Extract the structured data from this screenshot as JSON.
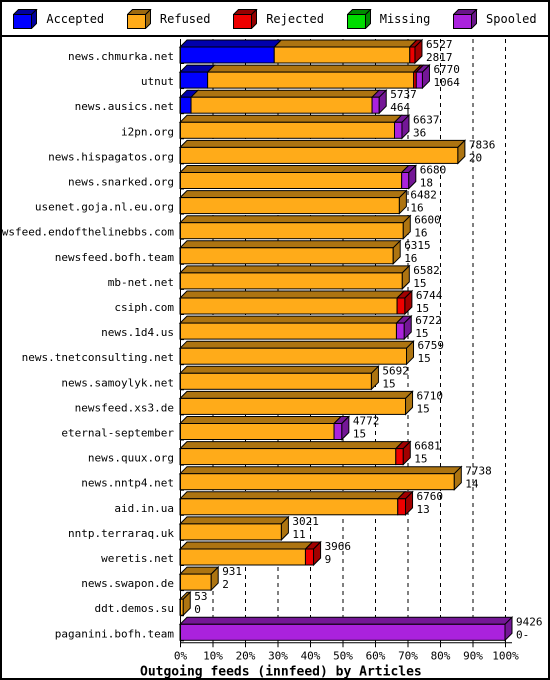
{
  "legend": {
    "items": [
      {
        "label": "Accepted",
        "color": "#0000ff",
        "icon": "cube-icon"
      },
      {
        "label": "Refused",
        "color": "#ffab19",
        "icon": "cube-icon"
      },
      {
        "label": "Rejected",
        "color": "#ee0000",
        "icon": "cube-icon"
      },
      {
        "label": "Missing",
        "color": "#00dd00",
        "icon": "cube-icon"
      },
      {
        "label": "Spooled",
        "color": "#aa22dd",
        "icon": "cube-icon"
      }
    ]
  },
  "chart_data": {
    "type": "bar",
    "orientation": "horizontal",
    "stacked": true,
    "title": "Outgoing feeds (innfeed) by Articles",
    "xlabel": "Outgoing feeds (innfeed) by Articles",
    "ylabel": "",
    "xlim": [
      0,
      100
    ],
    "x_tick_labels": [
      "0%",
      "10%",
      "20%",
      "30%",
      "40%",
      "50%",
      "60%",
      "70%",
      "80%",
      "90%",
      "100%"
    ],
    "x_tick_values": [
      0,
      10,
      20,
      30,
      40,
      50,
      60,
      70,
      80,
      90,
      100
    ],
    "grid": true,
    "legend_position": "top",
    "series": [
      {
        "name": "Accepted",
        "color": "#0000ff"
      },
      {
        "name": "Refused",
        "color": "#ffab19"
      },
      {
        "name": "Rejected",
        "color": "#ee0000"
      },
      {
        "name": "Missing",
        "color": "#00dd00"
      },
      {
        "name": "Spooled",
        "color": "#aa22dd"
      }
    ],
    "categories": [
      "news.chmurka.net",
      "utnut",
      "news.ausics.net",
      "i2pn.org",
      "news.hispagatos.org",
      "news.snarked.org",
      "usenet.goja.nl.eu.org",
      "newsfeed.endofthelinebbs.com",
      "newsfeed.bofh.team",
      "mb-net.net",
      "csiph.com",
      "news.1d4.us",
      "news.tnetconsulting.net",
      "news.samoylyk.net",
      "newsfeed.xs3.de",
      "eternal-september",
      "news.quux.org",
      "news.nntp4.net",
      "aid.in.ua",
      "nntp.terraraq.uk",
      "weretis.net",
      "news.swapon.de",
      "ddt.demos.su",
      "paganini.bofh.team"
    ],
    "rows": [
      {
        "category": "news.chmurka.net",
        "total": 6527,
        "label_top": "6527",
        "label_bottom": "2817",
        "segments": [
          {
            "series": "Accepted",
            "pct": 29.0
          },
          {
            "series": "Refused",
            "pct": 41.7
          },
          {
            "series": "Rejected",
            "pct": 1.6
          }
        ]
      },
      {
        "category": "utnut",
        "total": 6770,
        "label_top": "6770",
        "label_bottom": "1064",
        "segments": [
          {
            "series": "Accepted",
            "pct": 8.5
          },
          {
            "series": "Refused",
            "pct": 63.4
          },
          {
            "series": "Rejected",
            "pct": 0.8
          },
          {
            "series": "Spooled",
            "pct": 1.9
          }
        ]
      },
      {
        "category": "news.ausics.net",
        "total": 5737,
        "label_top": "5737",
        "label_bottom": "464",
        "segments": [
          {
            "series": "Accepted",
            "pct": 3.4
          },
          {
            "series": "Refused",
            "pct": 55.7
          },
          {
            "series": "Spooled",
            "pct": 2.2
          }
        ]
      },
      {
        "category": "i2pn.org",
        "total": 6637,
        "label_top": "6637",
        "label_bottom": "36",
        "segments": [
          {
            "series": "Refused",
            "pct": 66.0
          },
          {
            "series": "Spooled",
            "pct": 2.3
          }
        ]
      },
      {
        "category": "news.hispagatos.org",
        "total": 7836,
        "label_top": "7836",
        "label_bottom": "20",
        "segments": [
          {
            "series": "Refused",
            "pct": 85.5
          }
        ]
      },
      {
        "category": "news.snarked.org",
        "total": 6680,
        "label_top": "6680",
        "label_bottom": "18",
        "segments": [
          {
            "series": "Refused",
            "pct": 68.2
          },
          {
            "series": "Spooled",
            "pct": 2.2
          }
        ]
      },
      {
        "category": "usenet.goja.nl.eu.org",
        "total": 6482,
        "label_top": "6482",
        "label_bottom": "16",
        "segments": [
          {
            "series": "Refused",
            "pct": 67.5
          }
        ]
      },
      {
        "category": "newsfeed.endofthelinebbs.com",
        "total": 6600,
        "label_top": "6600",
        "label_bottom": "16",
        "segments": [
          {
            "series": "Refused",
            "pct": 68.7
          }
        ]
      },
      {
        "category": "newsfeed.bofh.team",
        "total": 6315,
        "label_top": "6315",
        "label_bottom": "16",
        "segments": [
          {
            "series": "Refused",
            "pct": 65.6
          }
        ]
      },
      {
        "category": "mb-net.net",
        "total": 6582,
        "label_top": "6582",
        "label_bottom": "15",
        "segments": [
          {
            "series": "Refused",
            "pct": 68.4
          }
        ]
      },
      {
        "category": "csiph.com",
        "total": 6744,
        "label_top": "6744",
        "label_bottom": "15",
        "segments": [
          {
            "series": "Refused",
            "pct": 66.8
          },
          {
            "series": "Rejected",
            "pct": 2.4
          }
        ]
      },
      {
        "category": "news.1d4.us",
        "total": 6722,
        "label_top": "6722",
        "label_bottom": "15",
        "segments": [
          {
            "series": "Refused",
            "pct": 66.6
          },
          {
            "series": "Spooled",
            "pct": 2.4
          }
        ]
      },
      {
        "category": "news.tnetconsulting.net",
        "total": 6759,
        "label_top": "6759",
        "label_bottom": "15",
        "segments": [
          {
            "series": "Refused",
            "pct": 69.7
          }
        ]
      },
      {
        "category": "news.samoylyk.net",
        "total": 5692,
        "label_top": "5692",
        "label_bottom": "15",
        "segments": [
          {
            "series": "Refused",
            "pct": 58.9
          }
        ]
      },
      {
        "category": "newsfeed.xs3.de",
        "total": 6710,
        "label_top": "6710",
        "label_bottom": "15",
        "segments": [
          {
            "series": "Refused",
            "pct": 69.4
          }
        ]
      },
      {
        "category": "eternal-september",
        "total": 4772,
        "label_top": "4772",
        "label_bottom": "15",
        "segments": [
          {
            "series": "Refused",
            "pct": 47.4
          },
          {
            "series": "Spooled",
            "pct": 2.4
          }
        ]
      },
      {
        "category": "news.quux.org",
        "total": 6681,
        "label_top": "6681",
        "label_bottom": "15",
        "segments": [
          {
            "series": "Refused",
            "pct": 66.4
          },
          {
            "series": "Rejected",
            "pct": 2.3
          }
        ]
      },
      {
        "category": "news.nntp4.net",
        "total": 7738,
        "label_top": "7738",
        "label_bottom": "14",
        "segments": [
          {
            "series": "Refused",
            "pct": 84.4
          }
        ]
      },
      {
        "category": "aid.in.ua",
        "total": 6760,
        "label_top": "6760",
        "label_bottom": "13",
        "segments": [
          {
            "series": "Refused",
            "pct": 67.0
          },
          {
            "series": "Rejected",
            "pct": 2.4
          }
        ]
      },
      {
        "category": "nntp.terraraq.uk",
        "total": 3021,
        "label_top": "3021",
        "label_bottom": "11",
        "segments": [
          {
            "series": "Refused",
            "pct": 31.2
          }
        ]
      },
      {
        "category": "weretis.net",
        "total": 3966,
        "label_top": "3966",
        "label_bottom": "9",
        "segments": [
          {
            "series": "Refused",
            "pct": 38.6
          },
          {
            "series": "Rejected",
            "pct": 2.5
          }
        ]
      },
      {
        "category": "news.swapon.de",
        "total": 931,
        "label_top": "931",
        "label_bottom": "2",
        "segments": [
          {
            "series": "Refused",
            "pct": 9.6
          }
        ]
      },
      {
        "category": "ddt.demos.su",
        "total": 53,
        "label_top": "53",
        "label_bottom": "0",
        "segments": [
          {
            "series": "Refused",
            "pct": 1.0
          }
        ]
      },
      {
        "category": "paganini.bofh.team",
        "total": 9426,
        "label_top": "9426",
        "label_bottom": "0-",
        "segments": [
          {
            "series": "Spooled",
            "pct": 100.0
          }
        ]
      }
    ]
  }
}
